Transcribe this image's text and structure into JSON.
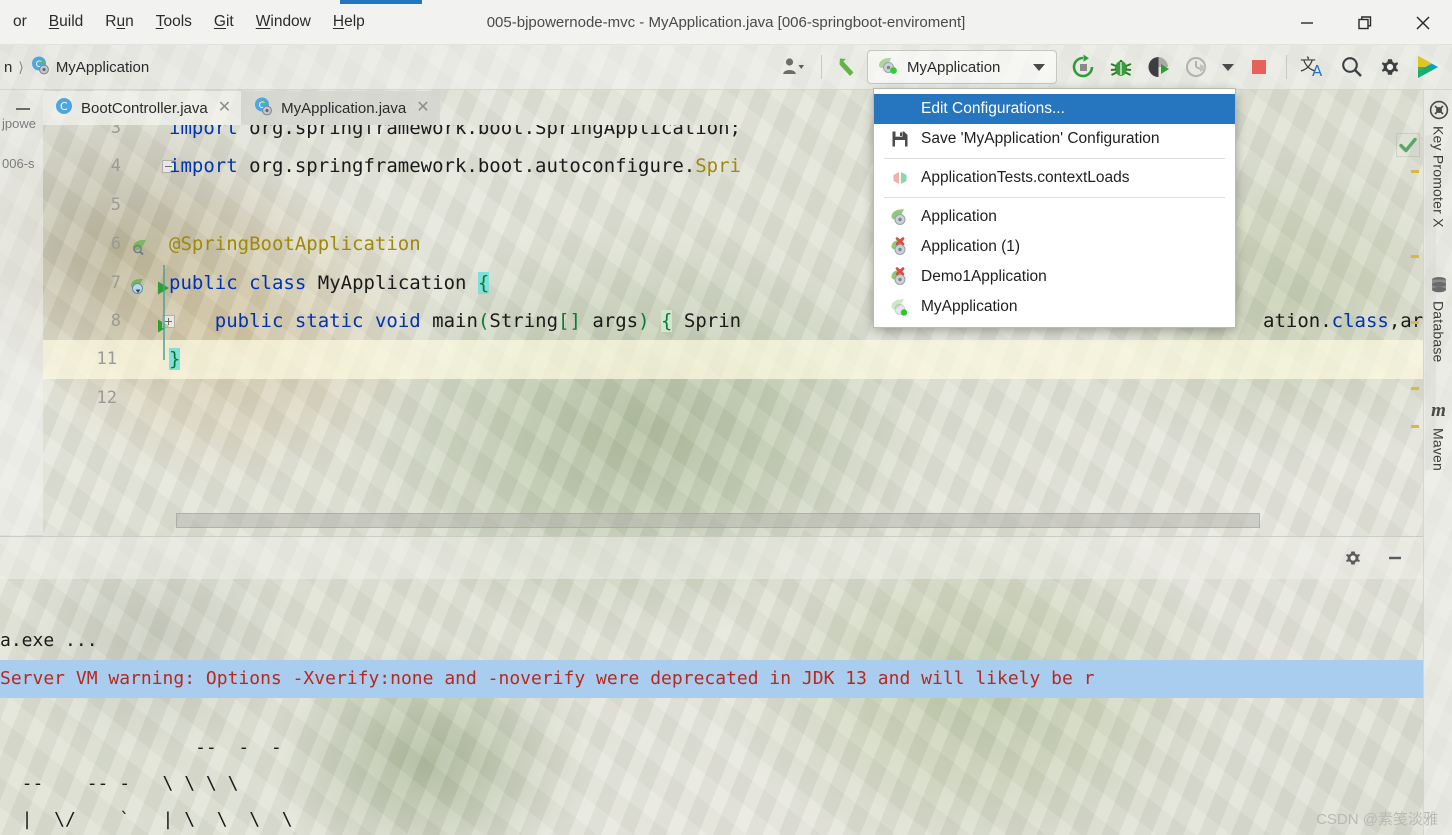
{
  "window": {
    "title": "005-bjpowernode-mvc - MyApplication.java [006-springboot-enviroment]",
    "minimize_label": "Minimize",
    "restore_label": "Restore",
    "close_label": "Close"
  },
  "menubar": {
    "items": [
      {
        "label": "or",
        "mnemonic": ""
      },
      {
        "label": "Build",
        "mnemonic": "B"
      },
      {
        "label": "Run",
        "mnemonic": "u"
      },
      {
        "label": "Tools",
        "mnemonic": "T"
      },
      {
        "label": "Git",
        "mnemonic": "G"
      },
      {
        "label": "Window",
        "mnemonic": "W"
      },
      {
        "label": "Help",
        "mnemonic": "H"
      }
    ]
  },
  "navbar": {
    "breadcrumb_prefix": "n",
    "breadcrumb_current": "MyApplication",
    "breadcrumb_icon": "spring-boot-class-icon",
    "run_config": {
      "name": "MyApplication",
      "icon": "spring-boot-run-icon",
      "chevron": "chevron-down-icon"
    },
    "toolbar_buttons": [
      {
        "name": "rerun-button",
        "icon": "rerun-icon",
        "tooltip": "Rerun"
      },
      {
        "name": "debug-button",
        "icon": "bug-icon",
        "tooltip": "Debug"
      },
      {
        "name": "run-with-coverage-button",
        "icon": "coverage-icon",
        "tooltip": "Run with Coverage"
      },
      {
        "name": "profiler-button",
        "icon": "profiler-icon",
        "tooltip": "Profiler",
        "disabled": true
      },
      {
        "name": "profiler-dropdown",
        "icon": "chevron-down-icon",
        "tooltip": "More"
      },
      {
        "name": "stop-button",
        "icon": "stop-square-icon",
        "tooltip": "Stop"
      },
      {
        "name": "translate-button",
        "icon": "translate-icon",
        "tooltip": "Translate"
      },
      {
        "name": "search-everywhere-button",
        "icon": "search-icon",
        "tooltip": "Search Everywhere"
      },
      {
        "name": "settings-button",
        "icon": "gear-icon",
        "tooltip": "Settings"
      },
      {
        "name": "ide-logo-button",
        "icon": "idea-play-logo-icon",
        "tooltip": "IDEA"
      }
    ],
    "account_icon": "user-account-icon",
    "vcs_update_icon": "vcs-update-arrow-icon"
  },
  "project_panel": {
    "collapse_icon": "collapse-icon",
    "entries": [
      "jpowe",
      "006-s"
    ]
  },
  "editor": {
    "tabs": [
      {
        "label": "BootController.java",
        "icon": "java-class-icon",
        "active": false,
        "close_icon": "close-icon"
      },
      {
        "label": "MyApplication.java",
        "icon": "spring-boot-class-icon",
        "active": true,
        "close_icon": "close-icon"
      }
    ],
    "inspection_status_icon": "green-check-icon",
    "lines": [
      {
        "number": "3",
        "text": "import org.springframework.boot.SpringApplication;",
        "clipped_top": true
      },
      {
        "number": "4",
        "text": "import org.springframework.boot.autoconfigure.SpringBootApplication;"
      },
      {
        "number": "5",
        "text": ""
      },
      {
        "number": "6",
        "text": "@SpringBootApplication"
      },
      {
        "number": "7",
        "text": "public class MyApplication {"
      },
      {
        "number": "8",
        "text": "    public static void main(String[] args) { SpringApplication.run(MyApplication.class, args); }"
      },
      {
        "number": "11",
        "text": "}",
        "current": true
      },
      {
        "number": "12",
        "text": ""
      }
    ],
    "line8_visible_tail": "ation.class,ar",
    "gutter_icons": [
      {
        "line": "6",
        "icon": "spring-bean-icon"
      },
      {
        "line": "7",
        "icon": "spring-boot-run-gutter-icon"
      },
      {
        "line": "7",
        "icon": "run-triangle-icon"
      },
      {
        "line": "8",
        "icon": "run-triangle-icon"
      }
    ]
  },
  "run_config_popup": {
    "groups": [
      {
        "items": [
          {
            "label": "Edit Configurations...",
            "icon": "none",
            "selected": true
          },
          {
            "label": "Save 'MyApplication' Configuration",
            "icon": "save-floppy-icon",
            "selected": false
          }
        ]
      },
      {
        "items": [
          {
            "label": "ApplicationTests.contextLoads",
            "icon": "junit-test-icon",
            "selected": false
          }
        ]
      },
      {
        "items": [
          {
            "label": "Application",
            "icon": "spring-boot-icon",
            "selected": false
          },
          {
            "label": "Application (1)",
            "icon": "spring-boot-error-icon",
            "selected": false
          },
          {
            "label": "Demo1Application",
            "icon": "spring-boot-error-icon",
            "selected": false
          },
          {
            "label": "MyApplication",
            "icon": "spring-boot-running-icon",
            "selected": false
          }
        ]
      }
    ]
  },
  "right_toolwindows": [
    {
      "label": "Key Promoter X",
      "icon": "key-promoter-icon"
    },
    {
      "label": "Database",
      "icon": "database-icon"
    },
    {
      "label": "Maven",
      "icon": "maven-m-icon"
    }
  ],
  "console": {
    "header_buttons": [
      {
        "name": "console-settings-button",
        "icon": "gear-icon"
      },
      {
        "name": "console-hide-button",
        "icon": "minimize-icon"
      }
    ],
    "lines": [
      {
        "text": "a.exe ...",
        "style": "normal"
      },
      {
        "text": "Server VM warning: Options -Xverify:none and -noverify were deprecated in JDK 13 and will likely be r",
        "style": "warning",
        "selected": true
      }
    ],
    "banner": [
      "                  --  -  -",
      "  --    -- -   \\ \\ \\ \\",
      "  |  \\/    `   | \\  \\  \\  \\"
    ]
  },
  "watermark": "CSDN @素笺淡雅"
}
